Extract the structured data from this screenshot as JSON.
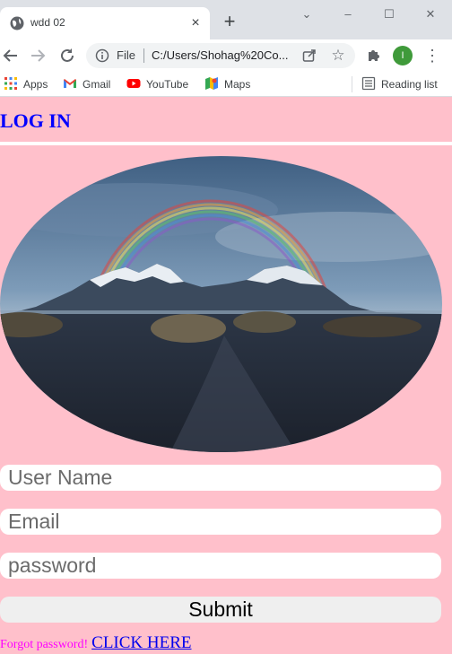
{
  "browser": {
    "tab_title": "wdd 02",
    "tab_close": "×",
    "new_tab": "+",
    "url_scheme": "File",
    "url": "C:/Users/Shohag%20Co...",
    "profile_initial": "I",
    "bookmarks": {
      "apps": "Apps",
      "gmail": "Gmail",
      "youtube": "YouTube",
      "maps": "Maps",
      "reading_list": "Reading list"
    },
    "window_controls": {
      "chevron": "⌄",
      "minimize": "–",
      "maximize": "☐",
      "close": "✕"
    }
  },
  "page": {
    "heading": "LOG IN",
    "hero_icon": "mountain-rainbow-image",
    "form": {
      "username_placeholder": "User Name",
      "email_placeholder": "Email",
      "password_placeholder": "password",
      "submit_label": "Submit"
    },
    "forgot_text": "Forgot password!",
    "click_link": "CLICK HERE"
  },
  "colors": {
    "page_background": "#ffc0cb",
    "heading": "#0000ff",
    "forgot_text": "#ff00ff",
    "link": "#0000ee"
  }
}
